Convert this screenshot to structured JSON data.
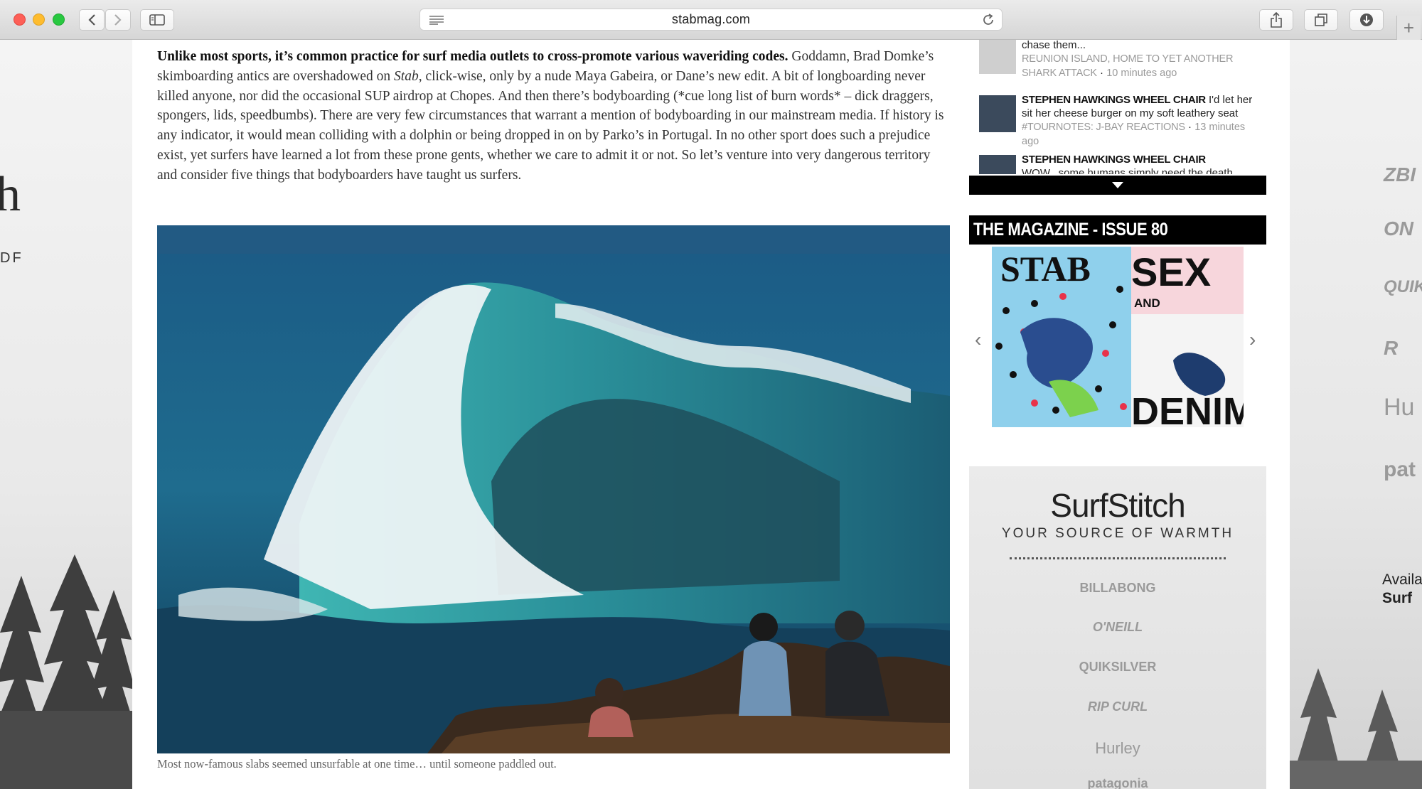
{
  "browser": {
    "url": "stabmag.com",
    "new_tab_symbol": "+"
  },
  "background": {
    "left_logo_fragment": "h",
    "left_sub_fragment": "DF",
    "right_brand_fragments": [
      "ZBI",
      "ON",
      "QUIK",
      "R",
      "Hu",
      "pat",
      "Availa",
      "Surf"
    ]
  },
  "article": {
    "lead": "Unlike most sports, it’s common practice for surf media outlets to cross-promote various waveriding codes.",
    "body_1": " Goddamn, Brad Domke’s skimboarding antics are overshadowed on ",
    "body_stab": "Stab",
    "body_2": ", click-wise, only by a nude Maya Gabeira, or Dane’s new edit. A bit of longboarding never killed anyone, nor did the occasional SUP airdrop at Chopes. And then there’s bodyboarding (*cue long list of burn words* – dick draggers, spongers, lids, speedbumbs). There are very few circumstances that warrant a mention of bodyboarding in our mainstream media. If history is any indicator, it would mean colliding with a dolphin or being dropped in on by Parko’s in Portugal. In no other sport does such a prejudice exist, yet surfers have learned a lot from these prone gents, whether we care to admit it or not. So let’s venture into very dangerous territory and consider five things that bodyboarders have taught us surfers.",
    "caption": "Most now-famous slabs seemed unsurfable at one time… until someone paddled out."
  },
  "sidebar": {
    "news": [
      {
        "headline": "",
        "snippet": "chase them...",
        "tag": "REUNION ISLAND, HOME TO YET ANOTHER SHARK ATTACK",
        "time": "10 minutes ago"
      },
      {
        "headline": "STEPHEN HAWKINGS WHEEL CHAIR",
        "snippet": "I'd let her sit her cheese burger on my soft leathery seat",
        "tag": "#TOURNOTES: J-BAY REACTIONS",
        "time": "13 minutes ago"
      },
      {
        "headline": "STEPHEN HAWKINGS WHEEL CHAIR",
        "snippet": "WOW...some humans simply need the death penalty",
        "tag": "",
        "time": ""
      }
    ],
    "magazine_title": "THE MAGAZINE - ISSUE 80",
    "cover": {
      "masthead": "STAB",
      "word_1": "SEX",
      "word_2": "AND",
      "word_3": "DENIM"
    },
    "ad": {
      "brand": "SurfStitch",
      "tagline": "YOUR SOURCE OF WARMTH",
      "logos": [
        "BILLABONG",
        "O'NEILL",
        "QUIKSILVER",
        "RIP CURL",
        "Hurley",
        "patagonia"
      ]
    }
  }
}
